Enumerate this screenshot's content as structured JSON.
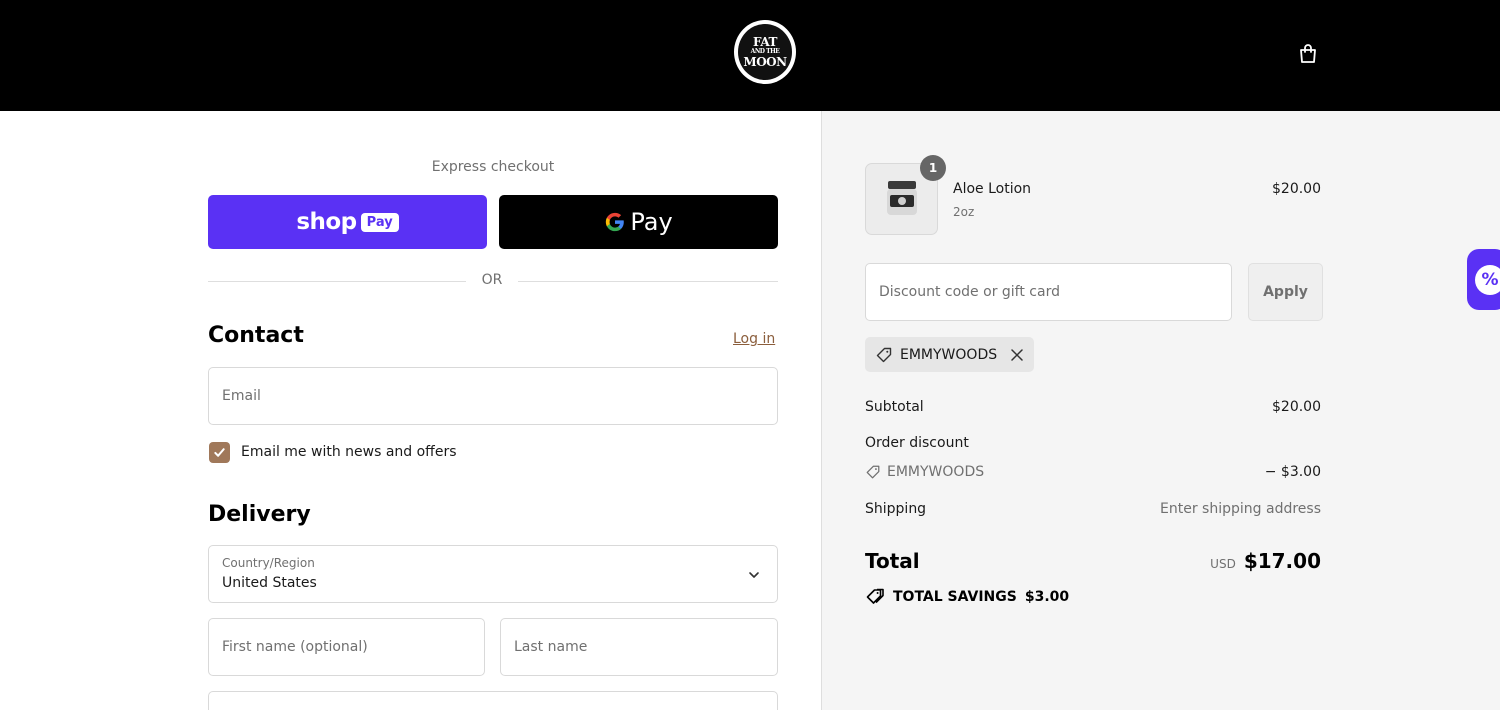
{
  "header": {
    "logo_line1": "FAT",
    "logo_line2": "AND THE",
    "logo_line3": "MOON",
    "cart_icon": "shopping-bag-icon"
  },
  "express": {
    "label": "Express checkout",
    "shop_pay_word": "shop",
    "shop_pay_badge": "Pay",
    "gpay_text": "Pay",
    "or_text": "OR"
  },
  "contact": {
    "title": "Contact",
    "login_label": "Log in",
    "email_placeholder": "Email",
    "newsletter_label": "Email me with news and offers",
    "newsletter_checked": true
  },
  "delivery": {
    "title": "Delivery",
    "country_label": "Country/Region",
    "country_value": "United States",
    "first_name_placeholder": "First name (optional)",
    "last_name_placeholder": "Last name"
  },
  "order": {
    "item_name": "Aloe Lotion",
    "item_variant": "2oz",
    "item_price": "$20.00",
    "item_quantity": "1",
    "discount_placeholder": "Discount code or gift card",
    "apply_label": "Apply",
    "applied_code": "EMMYWOODS",
    "subtotal_label": "Subtotal",
    "subtotal_value": "$20.00",
    "order_discount_label": "Order discount",
    "discount_code_label": "EMMYWOODS",
    "discount_value": "− $3.00",
    "shipping_label": "Shipping",
    "shipping_value": "Enter shipping address",
    "total_label": "Total",
    "total_currency": "USD",
    "total_value": "$17.00",
    "savings_label": "TOTAL SAVINGS",
    "savings_value": "$3.00"
  },
  "colors": {
    "shop_pay": "#5a31f4",
    "accent_brown": "#a0785a",
    "link_brown": "#8b5e3c"
  }
}
